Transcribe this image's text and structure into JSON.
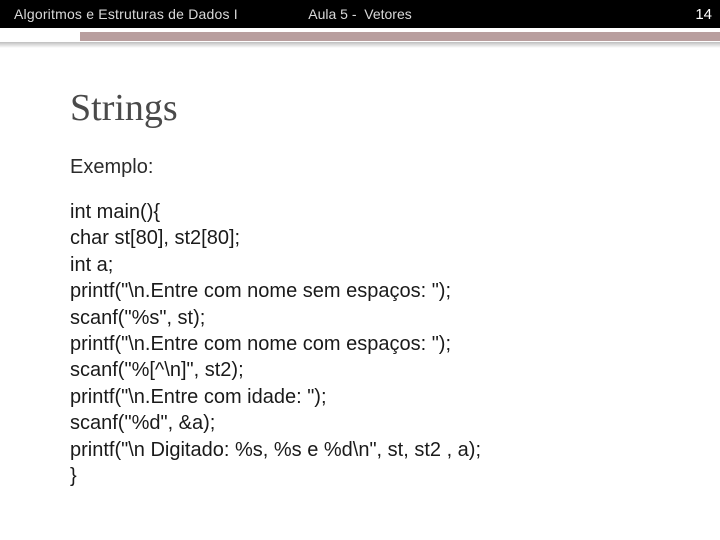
{
  "header": {
    "course": "Algoritmos e Estruturas de Dados I",
    "lecture": "Aula 5 -  Vetores",
    "page": "14"
  },
  "content": {
    "title": "Strings",
    "subtitle": "Exemplo:",
    "code": [
      "int main(){",
      "char st[80], st2[80];",
      "int a;",
      "printf(\"\\n.Entre com nome sem espaços: \");",
      "scanf(\"%s\", st);",
      "printf(\"\\n.Entre com nome com espaços: \");",
      "scanf(\"%[^\\n]\", st2);",
      "printf(\"\\n.Entre com idade: \");",
      "scanf(\"%d\", &a);",
      "printf(\"\\n Digitado: %s, %s e %d\\n\", st, st2 , a);",
      "}"
    ]
  }
}
